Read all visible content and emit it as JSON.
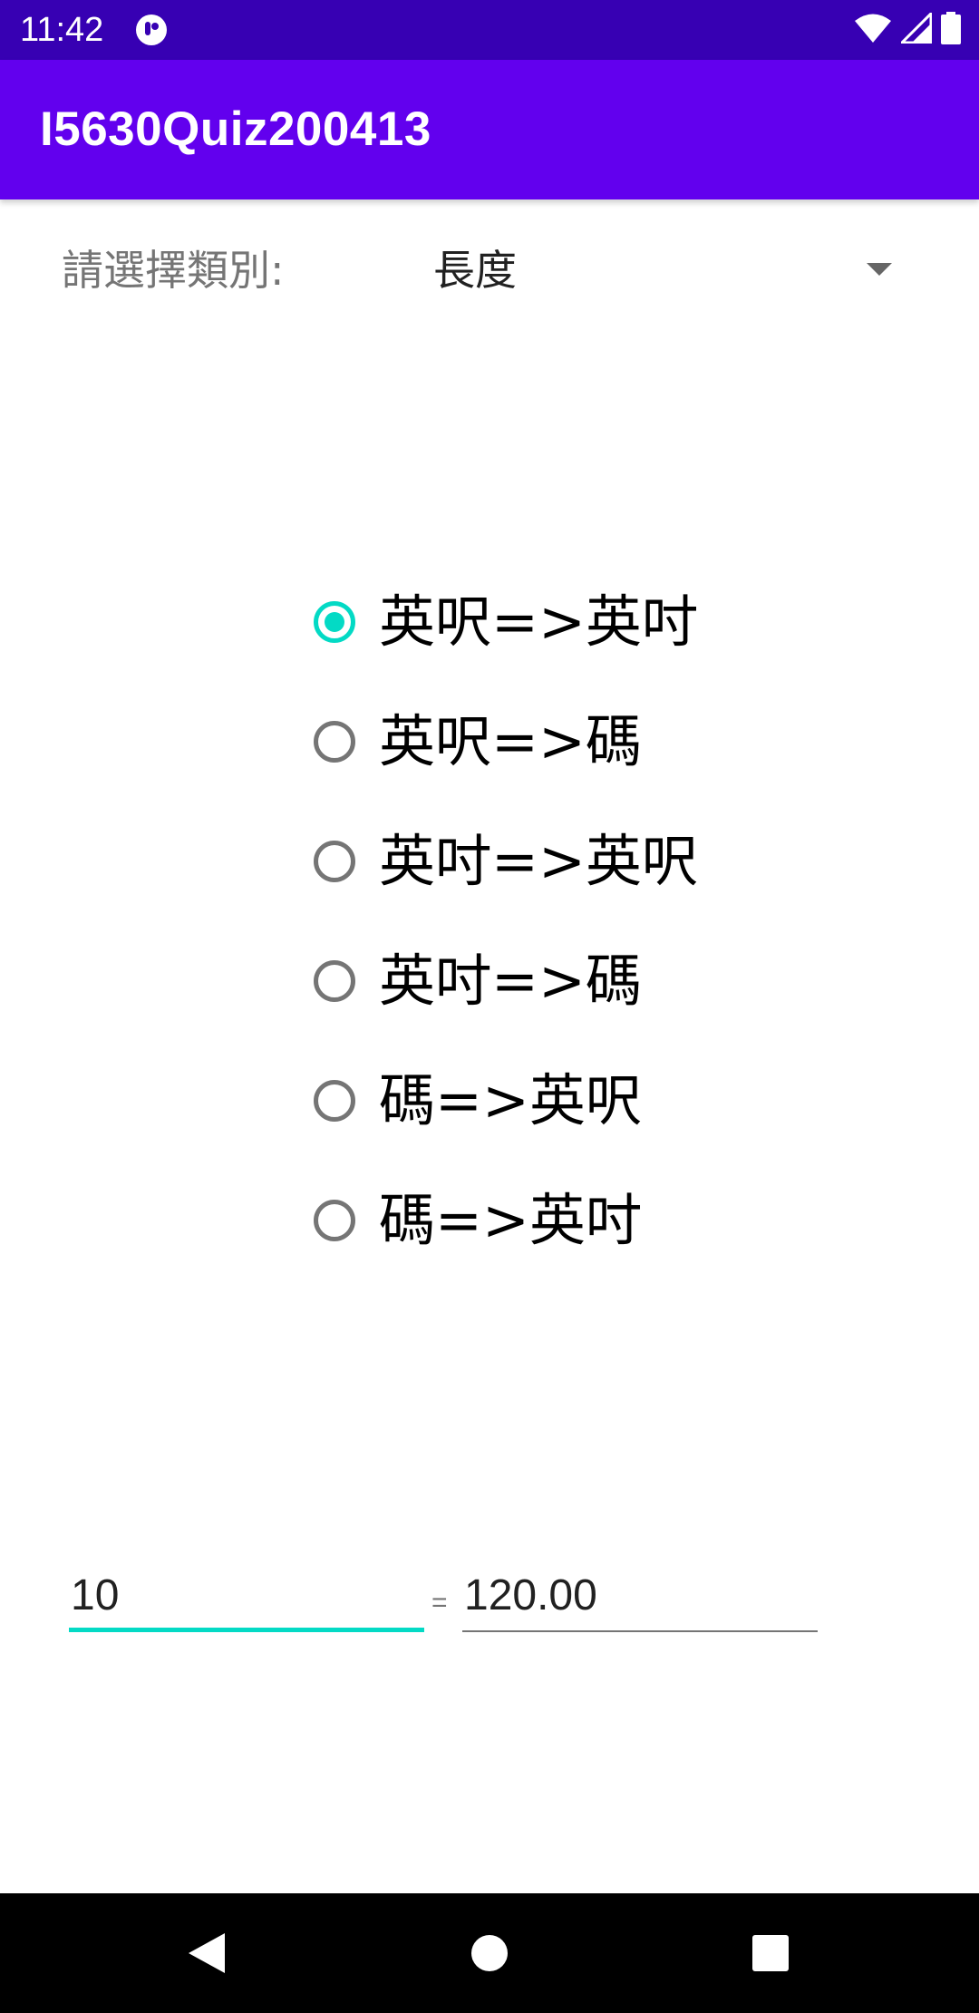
{
  "status_bar": {
    "time": "11:42",
    "background_color": "#3700B3",
    "icons": [
      "app-notification-icon",
      "wifi-icon",
      "cellular-signal-icon",
      "battery-icon"
    ]
  },
  "app_bar": {
    "title": "I5630Quiz200413",
    "background_color": "#6200EE"
  },
  "category": {
    "label": "請選擇類別:",
    "selected": "長度"
  },
  "conversions": {
    "accent_color": "#03DAC5",
    "selected_index": 0,
    "options": [
      {
        "label": "英呎=>英吋",
        "checked": true
      },
      {
        "label": "英呎=>碼",
        "checked": false
      },
      {
        "label": "英吋=>英呎",
        "checked": false
      },
      {
        "label": "英吋=>碼",
        "checked": false
      },
      {
        "label": "碼=>英呎",
        "checked": false
      },
      {
        "label": "碼=>英吋",
        "checked": false
      }
    ]
  },
  "calculation": {
    "input_value": "10",
    "equals": "=",
    "result_value": "120.00"
  },
  "navigation": {
    "icons": [
      "back-icon",
      "home-icon",
      "recents-icon"
    ]
  }
}
